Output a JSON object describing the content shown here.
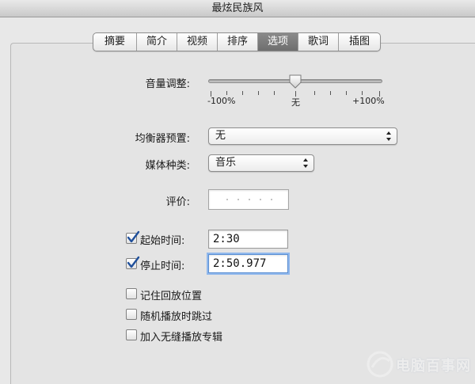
{
  "window": {
    "title": "最炫民族风"
  },
  "tabs": [
    {
      "label": "摘要",
      "selected": false
    },
    {
      "label": "简介",
      "selected": false
    },
    {
      "label": "视频",
      "selected": false
    },
    {
      "label": "排序",
      "selected": false
    },
    {
      "label": "选项",
      "selected": true
    },
    {
      "label": "歌词",
      "selected": false
    },
    {
      "label": "插图",
      "selected": false
    }
  ],
  "volume": {
    "label": "音量调整:",
    "value_percent": 0,
    "min_label": "-100%",
    "mid_label": "无",
    "max_label": "+100%"
  },
  "equalizer": {
    "label": "均衡器预置:",
    "value": "无"
  },
  "media_kind": {
    "label": "媒体种类:",
    "value": "音乐"
  },
  "rating": {
    "label": "评价:",
    "stars": 0,
    "max_stars": 5
  },
  "start_time": {
    "label": "起始时间:",
    "checked": true,
    "value": "2:30"
  },
  "stop_time": {
    "label": "停止时间:",
    "checked": true,
    "value": "2:50.977"
  },
  "options": [
    {
      "label": "记住回放位置",
      "checked": false
    },
    {
      "label": "随机播放时跳过",
      "checked": false
    },
    {
      "label": "加入无缝播放专辑",
      "checked": false
    }
  ],
  "watermark": {
    "text": "电脑百事网"
  },
  "colors": {
    "focus_ring": "#8fb7ec",
    "selected_tab": "#7a7a7a",
    "check": "#1f4f9a"
  }
}
